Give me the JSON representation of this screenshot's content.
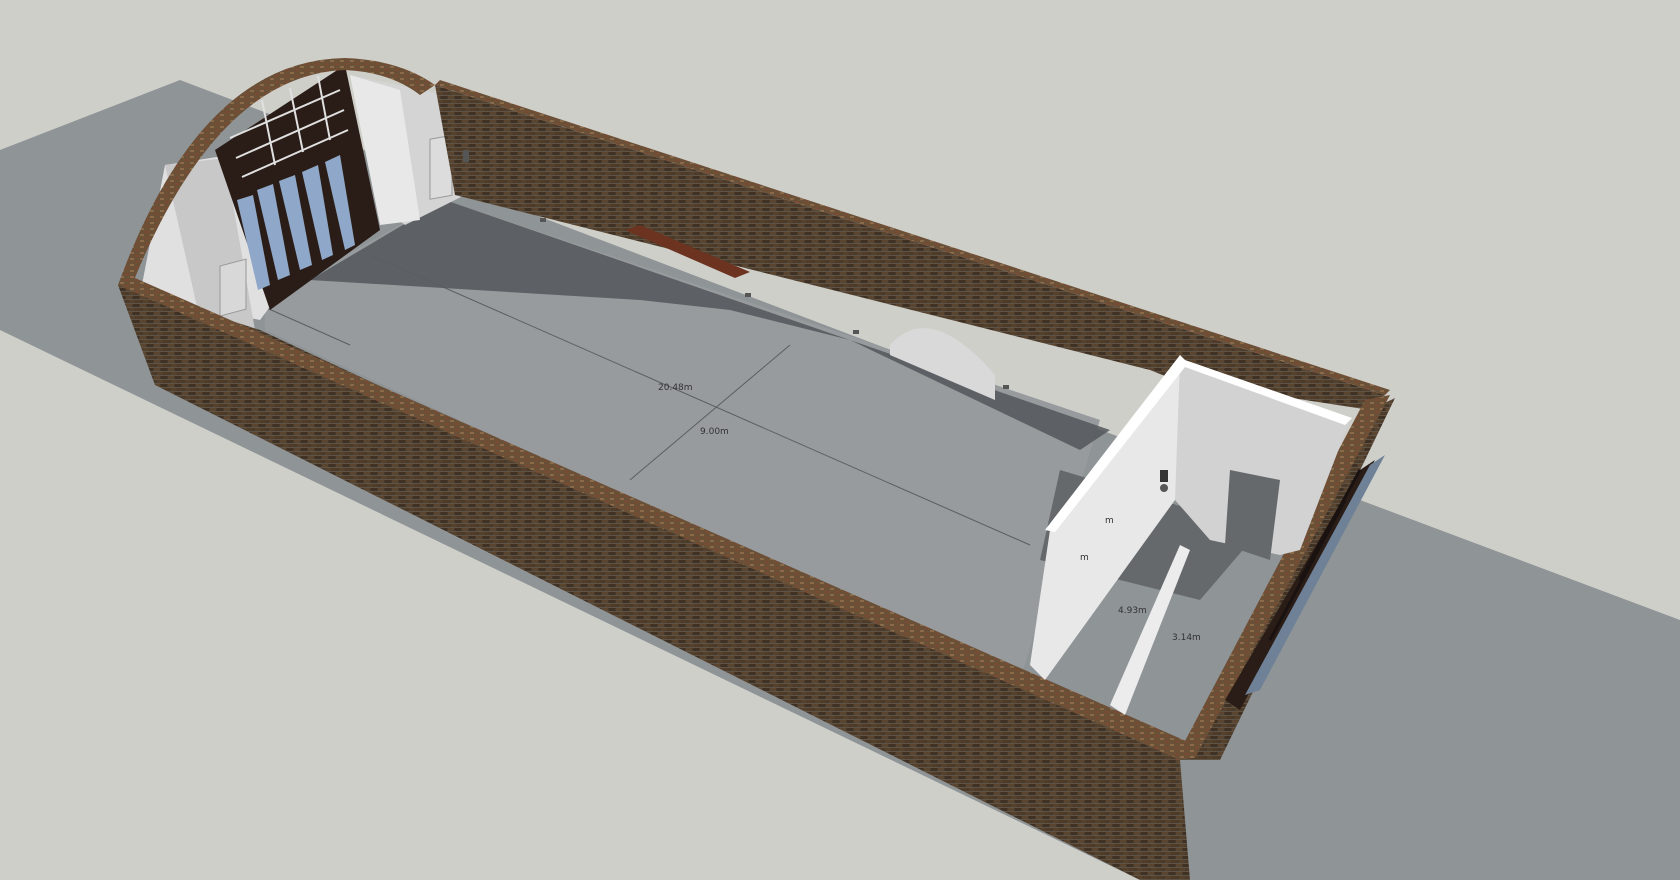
{
  "model_view": {
    "background_color": "#cfcfca",
    "ground_color": "#8f9497",
    "floor_color": "#979b9e",
    "floor_shadow_color": "#52575b",
    "brick_color": "#4a3a2a",
    "brick_cap_color": "#6b5038",
    "interior_wall_color": "#e8e8e8",
    "glass_color": "#8fa7c8",
    "frame_color": "#2a1d17",
    "bench_color": "#6b3320",
    "dimensions": {
      "length": "20.48m",
      "width": "9.00m",
      "partition_a": "4.93m",
      "partition_b": "3.14m",
      "wall_a": "m",
      "wall_b": "m"
    },
    "icons": [
      "light-switch-icon",
      "wall-lamp-icon",
      "floor-light-icon"
    ]
  }
}
